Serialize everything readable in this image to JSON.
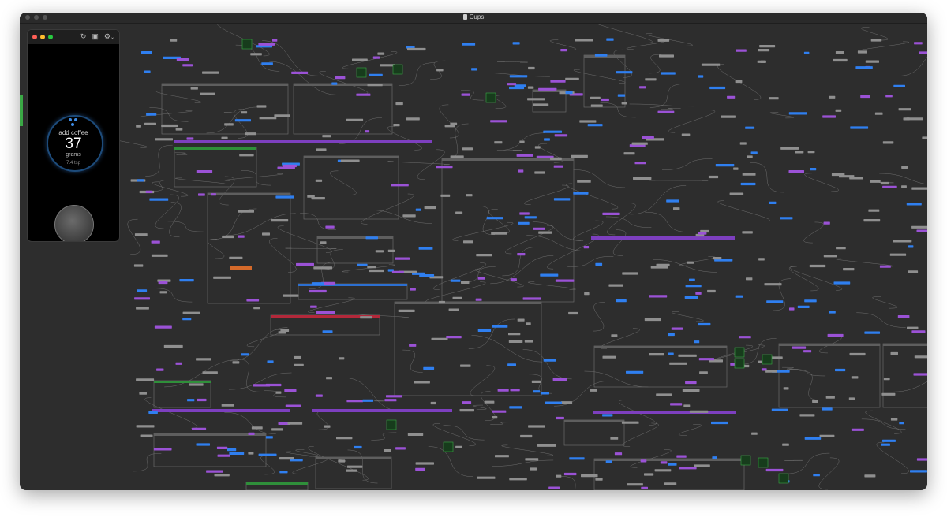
{
  "window": {
    "title": "Cups"
  },
  "preview": {
    "action": "add coffee",
    "amount": "37",
    "unit": "grams",
    "secondary": "7.4 tsp"
  },
  "colors": {
    "canvas": "#2d2d2d",
    "node": "#8f8f8f",
    "patch_purple": "#9b52d6",
    "patch_blue": "#2f7ff0",
    "group_purple": "#7d3fbf",
    "group_green": "#2f8f3a",
    "group_blue": "#2c6fd0",
    "group_red": "#b3283a",
    "group_orange": "#d56a2a",
    "accent_dial": "#3f8de6"
  },
  "icons": [
    "document-icon",
    "refresh-icon",
    "record-icon",
    "settings-icon",
    "chevron-down-icon"
  ]
}
